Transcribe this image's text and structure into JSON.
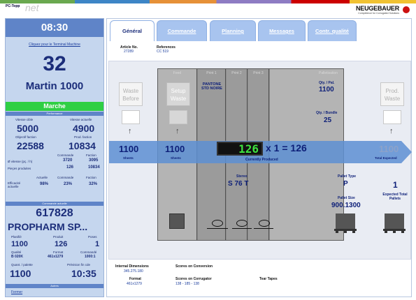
{
  "app": {
    "title": "PC-Topp",
    "logo_text": "net",
    "brand": "NEUGEBAUER",
    "brand_sub": "Competence for Corrugated Solutions"
  },
  "left": {
    "time": "08:30",
    "link_terminal": "Cliquez pour le Terminal Machine",
    "machine_number": "32",
    "machine_name": "Martin 1000",
    "status": "Marche",
    "sec_performance": "Performance",
    "vitesse_cible_lbl": "Vitesse cible",
    "vitesse_cible": "5000",
    "vitesse_actuelle_lbl": "Vitesse actuelle",
    "vitesse_actuelle": "4900",
    "objectif_lbl": "Objectif faction",
    "objectif": "22588",
    "prod_faction_lbl": "Prod. faction",
    "prod_faction": "10834",
    "col_commande": "Commande",
    "col_faction": "Faction",
    "vitesse_pcs_lbl": "Ø vitesse (pç. / h)",
    "vitesse_pcs_cmd": "3720",
    "vitesse_pcs_fact": "3095",
    "pieces_lbl": "Pieçes produites",
    "pieces_cmd": "126",
    "pieces_fact": "10834",
    "col_actuelle": "Actuelle",
    "col_commande2": "Commande",
    "col_faction2": "Faction",
    "efficacite_lbl": "Efficacité actuelle",
    "eff_act": "98%",
    "eff_cmd": "23%",
    "eff_fact": "32%",
    "sec_commande": "Commande actuelle",
    "order_number": "617828",
    "customer": "PROPHARM SP...",
    "planifie_lbl": "Planifié",
    "planifie": "1100",
    "produit_lbl": "Produit",
    "produit": "126",
    "poses_lbl": "Poses",
    "poses": "1",
    "qualite_lbl": "Qualité",
    "qualite": "B 020K",
    "format_lbl": "Format",
    "format": "461x1279",
    "commande_lbl": "Commandé",
    "commande": "1000:1",
    "quant_palette_lbl": "Quant. / palette",
    "quant_palette": "1100",
    "prevision_lbl": "Prévision fin cde",
    "prevision": "10:35",
    "sec_autres": "Autres",
    "fermer": "Fermer"
  },
  "tabs": [
    "Général",
    "Commande",
    "Planning",
    "Messages",
    "Contr. qualité"
  ],
  "info": {
    "article_lbl": "Article No.",
    "article": "27289",
    "references_lbl": "References",
    "references": "CC 519"
  },
  "process": {
    "waste_before": "Waste Before",
    "setup_waste": "Setup Waste",
    "prod_waste": "Prod. Waste",
    "unit_feed": "Feed",
    "unit_print1": "Print 1",
    "unit_print2": "Print 2",
    "unit_print3": "Print 3",
    "unit_palletisation": "Palletisation",
    "pantone": "PANTONE STD NOIRE",
    "sheets_val": "1100",
    "sheets_lbl": "Sheets",
    "setup_val": "1100",
    "setup_lbl": "Sheets",
    "counter": "126",
    "counter_formula": "x 1 = 126",
    "currently_produced": "Currently Produced",
    "total_expected_val": "1100",
    "total_expected_lbl": "Total Expected",
    "qty_pal_lbl": "Qty. / Pal.",
    "qty_pal": "1100",
    "qty_bundle_lbl": "Qty. / Bundle",
    "qty_bundle": "25",
    "stereo_lbl": "Stereo",
    "stereo": "S 76 T",
    "pallet_type_lbl": "Pallet Type",
    "pallet_type": "P",
    "pallet_size_lbl": "Pallet Size",
    "pallet_size": "900.1300",
    "expected_pallets_val": "1",
    "expected_pallets_lbl": "Expected Total Pallets"
  },
  "bottom": {
    "internal_dim_lbl": "Internal Dimensions",
    "internal_dim": "345.275.180",
    "format_lbl": "Format",
    "format": "461x1279",
    "scores_conv_lbl": "Scores on Conversion",
    "scores_corr_lbl": "Scores on Corrugator",
    "scores_corr": "138 - 185 - 138",
    "tear_tapes_lbl": "Tear Tapes"
  }
}
